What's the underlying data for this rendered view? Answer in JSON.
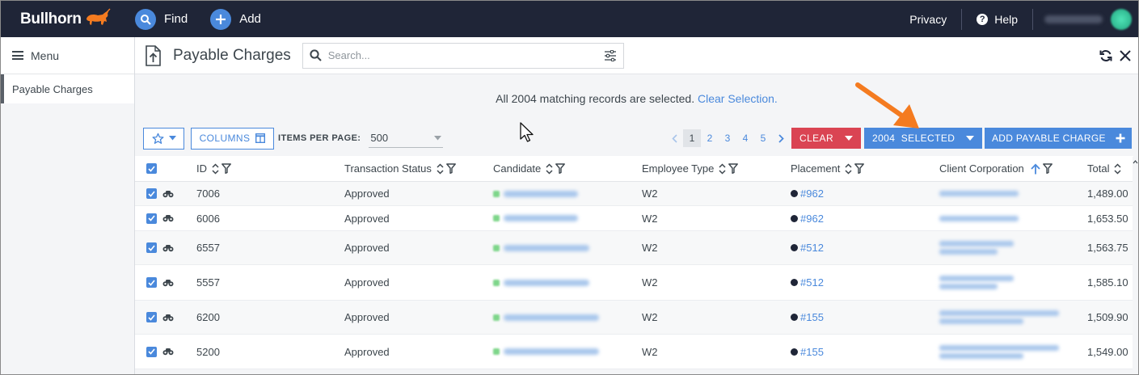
{
  "app": {
    "brand": "Bullhorn",
    "find_label": "Find",
    "add_label": "Add",
    "privacy_label": "Privacy",
    "help_label": "Help"
  },
  "sidebar": {
    "menu_label": "Menu",
    "items": [
      {
        "label": "Payable Charges"
      }
    ]
  },
  "header": {
    "title": "Payable Charges",
    "search_placeholder": "Search..."
  },
  "selection": {
    "message": "All 2004 matching records are selected.",
    "clear_link": "Clear Selection."
  },
  "toolbar": {
    "columns_label": "COLUMNS",
    "items_per_page_label": "ITEMS PER PAGE:",
    "items_per_page_value": "500",
    "pages": [
      "1",
      "2",
      "3",
      "4",
      "5"
    ],
    "active_page": "1",
    "clear_label": "CLEAR",
    "selected_label": "2004  SELECTED",
    "add_label": "ADD PAYABLE CHARGE"
  },
  "table": {
    "columns": [
      "ID",
      "Transaction Status",
      "Candidate",
      "Employee Type",
      "Placement",
      "Client Corporation",
      "Total"
    ],
    "rows": [
      {
        "id": "7006",
        "status": "Approved",
        "employee_type": "W2",
        "placement": "#962",
        "total": "1,489.00"
      },
      {
        "id": "6006",
        "status": "Approved",
        "employee_type": "W2",
        "placement": "#962",
        "total": "1,653.50"
      },
      {
        "id": "6557",
        "status": "Approved",
        "employee_type": "W2",
        "placement": "#512",
        "total": "1,563.75"
      },
      {
        "id": "5557",
        "status": "Approved",
        "employee_type": "W2",
        "placement": "#512",
        "total": "1,585.10"
      },
      {
        "id": "6200",
        "status": "Approved",
        "employee_type": "W2",
        "placement": "#155",
        "total": "1,509.90"
      },
      {
        "id": "5200",
        "status": "Approved",
        "employee_type": "W2",
        "placement": "#155",
        "total": "1,549.00"
      }
    ]
  },
  "colors": {
    "nav_bg": "#1f2537",
    "accent": "#4a89dc",
    "danger": "#da4453",
    "annotation": "#f47b20"
  }
}
